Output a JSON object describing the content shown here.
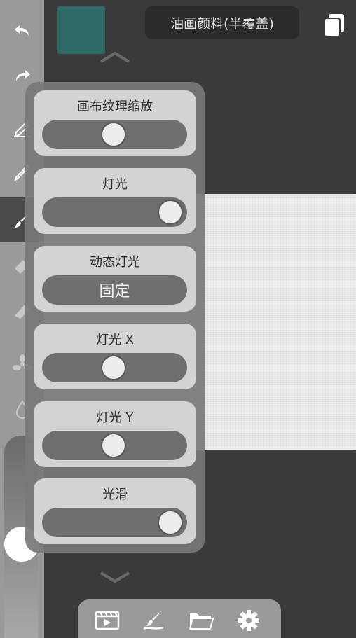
{
  "colors": {
    "current_color": "#2e6b67"
  },
  "header": {
    "brush_name": "油画颜料(半覆盖)"
  },
  "left_toolbar": {
    "tools": [
      {
        "name": "undo-icon"
      },
      {
        "name": "redo-icon"
      },
      {
        "name": "pen-icon"
      },
      {
        "name": "eyedropper-icon"
      },
      {
        "name": "brush-icon",
        "active": true
      },
      {
        "name": "eraser-icon"
      },
      {
        "name": "smudge-icon"
      },
      {
        "name": "fan-brush-icon"
      },
      {
        "name": "water-drop-icon"
      }
    ]
  },
  "panel": {
    "canvas_texture_zoom": {
      "label": "画布纹理缩放",
      "value": 0.5
    },
    "light": {
      "label": "灯光",
      "value": 1.0
    },
    "dynamic_light": {
      "label": "动态灯光",
      "button": "固定"
    },
    "light_x": {
      "label": "灯光 X",
      "value": 0.5
    },
    "light_y": {
      "label": "灯光 Y",
      "value": 0.5
    },
    "smooth": {
      "label": "光滑",
      "value": 1.0
    }
  },
  "bottom_bar": {
    "items": [
      "film-icon",
      "brush-stroke-icon",
      "folder-icon",
      "gear-icon"
    ]
  }
}
